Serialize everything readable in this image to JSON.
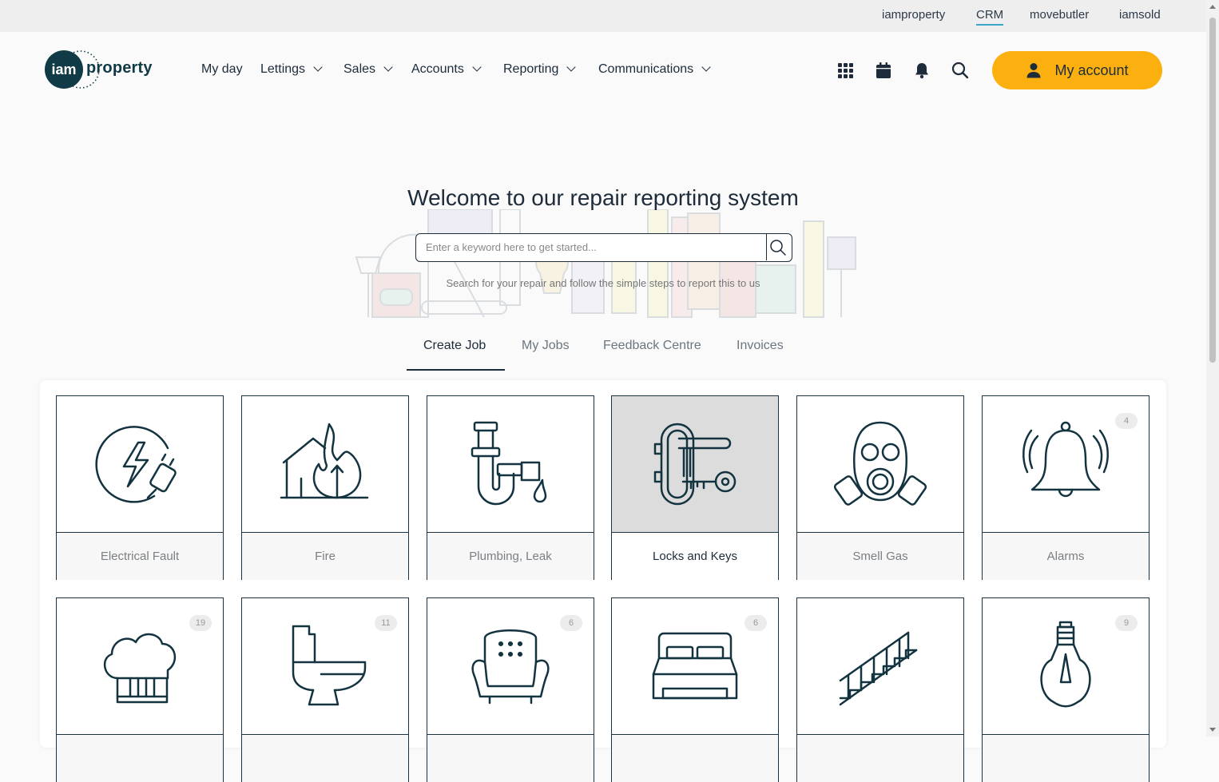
{
  "top_links": [
    "iamproperty",
    "CRM",
    "movebutler",
    "iamsold"
  ],
  "active_top_link": "CRM",
  "logo": {
    "badge": "iam",
    "text": "property"
  },
  "nav": [
    {
      "label": "My day"
    },
    {
      "label": "Lettings"
    },
    {
      "label": "Sales"
    },
    {
      "label": "Accounts"
    },
    {
      "label": "Reporting"
    },
    {
      "label": "Communications"
    }
  ],
  "header_icons": [
    "apps-grid-icon",
    "calendar-icon",
    "bell-icon",
    "search-icon"
  ],
  "account": {
    "label": "My account",
    "color": "#fbb010"
  },
  "hero": {
    "title": "Welcome to our repair reporting system",
    "search_placeholder": "Enter a keyword here to get started...",
    "subtitle": "Search for your repair and follow the simple steps to report this to us"
  },
  "tabs": [
    "Create Job",
    "My Jobs",
    "Feedback Centre",
    "Invoices"
  ],
  "active_tab": "Create Job",
  "categories": [
    {
      "label": "Electrical Fault",
      "icon": "electrical-fault-icon",
      "count": ""
    },
    {
      "label": "Fire",
      "icon": "fire-icon",
      "count": ""
    },
    {
      "label": "Plumbing, Leak",
      "icon": "plumbing-leak-icon",
      "count": ""
    },
    {
      "label": "Locks and Keys",
      "icon": "locks-keys-icon",
      "count": "",
      "selected": true
    },
    {
      "label": "Smell Gas",
      "icon": "gas-mask-icon",
      "count": ""
    },
    {
      "label": "Alarms",
      "icon": "alarm-bell-icon",
      "count": "4"
    },
    {
      "label": "",
      "icon": "chef-hat-icon",
      "count": "19"
    },
    {
      "label": "",
      "icon": "toilet-icon",
      "count": "11"
    },
    {
      "label": "",
      "icon": "armchair-icon",
      "count": "6"
    },
    {
      "label": "",
      "icon": "bed-icon",
      "count": "6"
    },
    {
      "label": "",
      "icon": "stairs-icon",
      "count": ""
    },
    {
      "label": "",
      "icon": "lightbulb-icon",
      "count": "9"
    }
  ],
  "colors": {
    "primary": "#1d2b3a",
    "logo": "#0f3a46",
    "accent": "#fbb010"
  }
}
